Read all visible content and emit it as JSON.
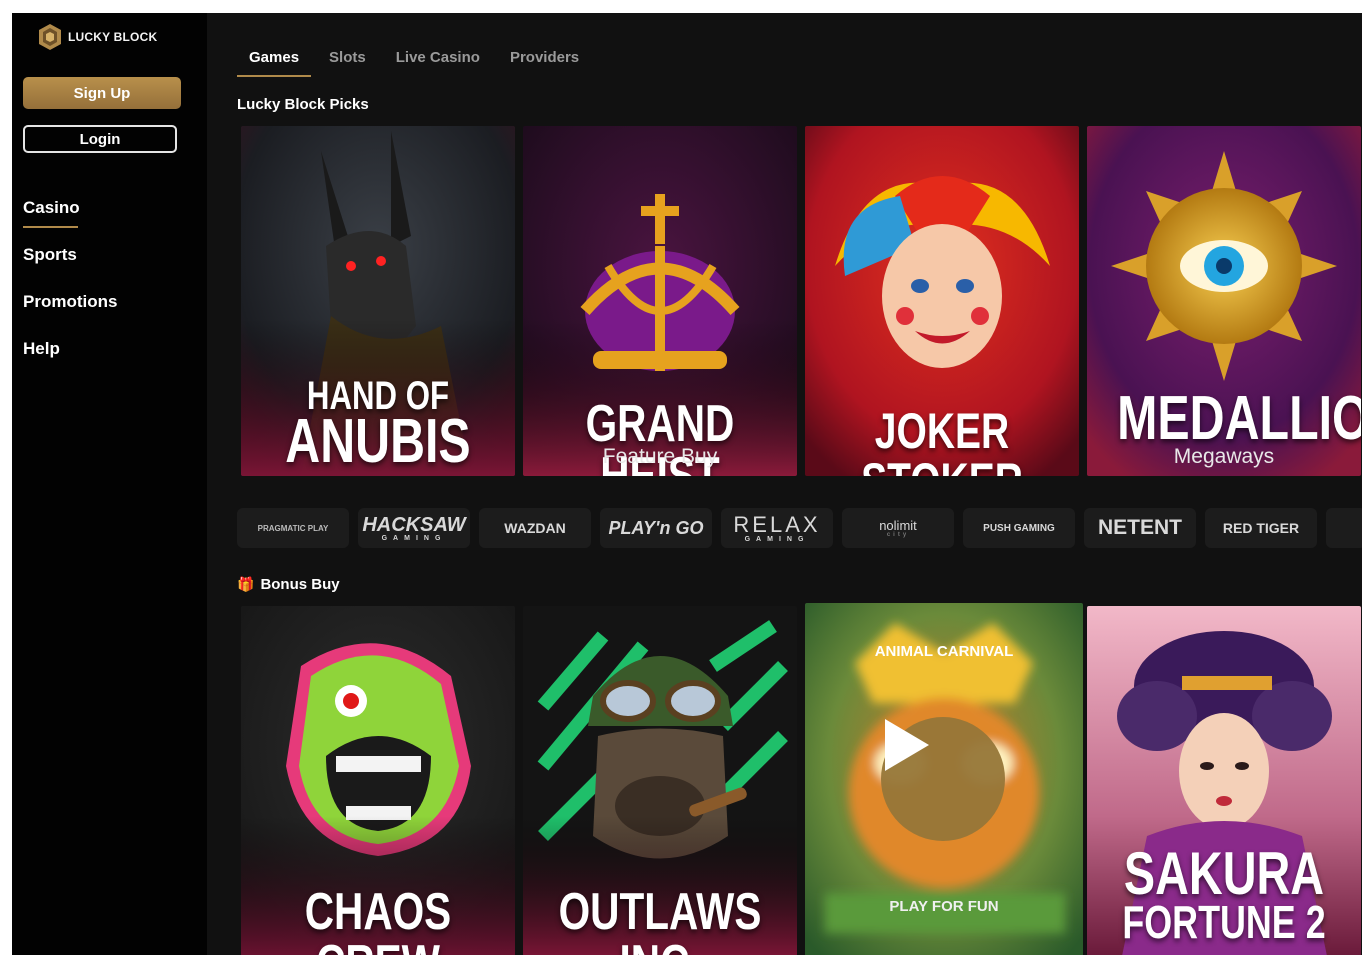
{
  "brand": {
    "name": "LUCKY BLOCK",
    "accent": "#b08a4a"
  },
  "sidebar": {
    "signup_label": "Sign Up",
    "login_label": "Login",
    "nav": [
      {
        "label": "Casino",
        "active": true
      },
      {
        "label": "Sports"
      },
      {
        "label": "Promotions"
      },
      {
        "label": "Help"
      }
    ]
  },
  "tabs": [
    {
      "label": "Games",
      "active": true
    },
    {
      "label": "Slots"
    },
    {
      "label": "Live Casino"
    },
    {
      "label": "Providers"
    }
  ],
  "sections": {
    "picks_title": "Lucky Block Picks",
    "bonus_title": "Bonus Buy",
    "bonus_icon": "gift-icon"
  },
  "picks": [
    {
      "line1": "HAND OF",
      "line2": "ANUBIS",
      "subtitle": ""
    },
    {
      "line1": "GRAND HEIST",
      "subtitle": "Feature Buy"
    },
    {
      "line1": "JOKER STOKER",
      "subtitle": ""
    },
    {
      "line1": "MEDALLION",
      "subtitle": "Megaways"
    }
  ],
  "providers": [
    "PRAGMATIC PLAY",
    "HACKSAW",
    "GAMING",
    "WAZDAN",
    "PLAY'n GO",
    "RELAX",
    "GAMING",
    "nolimit",
    "city",
    "PUSH GAMING",
    "NETENT",
    "RED TIGER"
  ],
  "bonus": [
    {
      "line1": "CHAOS CREW"
    },
    {
      "line1": "OUTLAWS INC."
    },
    {
      "hover_title": "ANIMAL CARNIVAL",
      "play_label": "PLAY FOR FUN"
    },
    {
      "line1": "SAKURA",
      "line2": "FORTUNE 2"
    }
  ]
}
